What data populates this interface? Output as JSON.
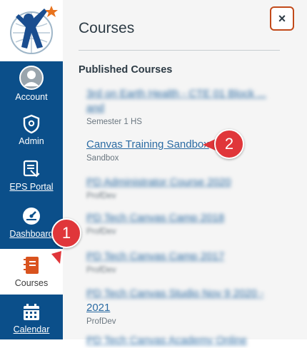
{
  "nav": {
    "account": "Account",
    "admin": "Admin",
    "eps_portal": "EPS Portal",
    "dashboard": "Dashboard",
    "courses": "Courses",
    "calendar": "Calendar"
  },
  "tray": {
    "title": "Courses",
    "close_icon": "×",
    "section_title": "Published Courses",
    "courses": [
      {
        "name": "3rd on Earth Health - CTE 01 Block ... and",
        "sub": "Semester 1 HS",
        "blurred": true
      },
      {
        "name": "Canvas Training Sandbox",
        "sub": "Sandbox",
        "blurred": false
      },
      {
        "name": "PD Administrator Course 2020",
        "sub": "ProfDev",
        "blurred": true
      },
      {
        "name": "PD Tech Canvas Camp 2018",
        "sub": "ProfDev",
        "blurred": true
      },
      {
        "name": "PD Tech Canvas Camp 2017",
        "sub": "ProfDev",
        "blurred": true
      },
      {
        "name": "PD Tech Canvas Studio Nov 9 2020 -",
        "name_suffix": "2021",
        "sub": "ProfDev",
        "blurred": true
      },
      {
        "name": "PD Tech Canvas Academy Online",
        "sub": "",
        "blurred": true
      }
    ]
  },
  "callouts": {
    "one": "1",
    "two": "2"
  },
  "colors": {
    "sidebar": "#0b4f8a",
    "accent_red": "#e0363a",
    "link": "#2b6ba3",
    "close_border": "#c24a1a"
  }
}
